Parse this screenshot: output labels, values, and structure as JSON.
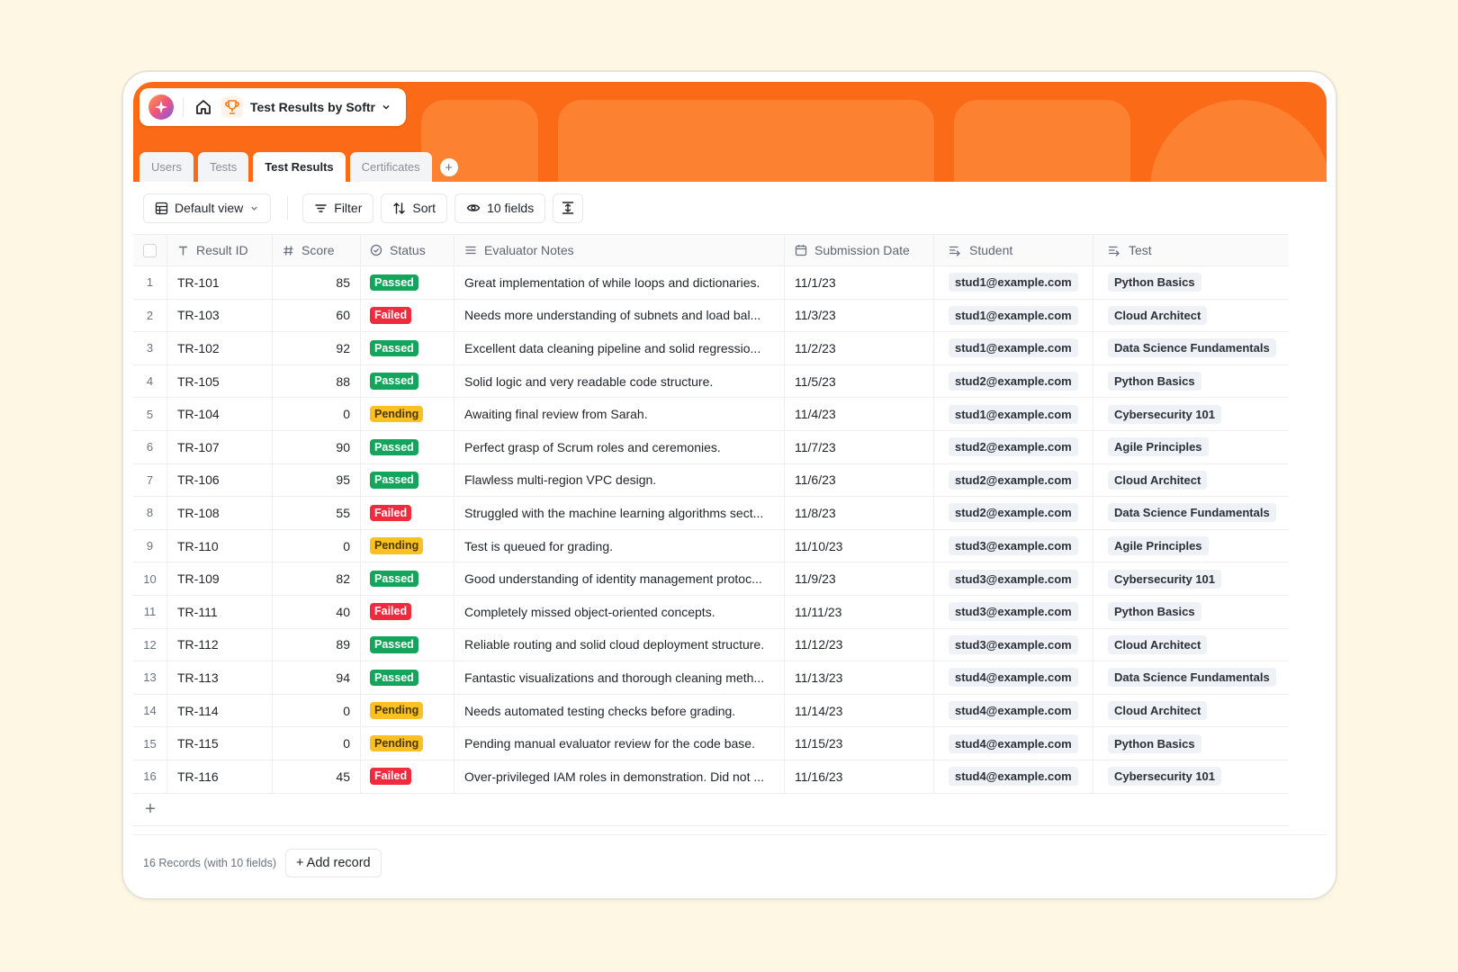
{
  "app": {
    "title": "Test Results by Softr",
    "tabs": [
      "Users",
      "Tests",
      "Test Results",
      "Certificates"
    ],
    "active_tab": "Test Results",
    "add_tab_label": "+"
  },
  "toolbar": {
    "view_label": "Default view",
    "filter_label": "Filter",
    "sort_label": "Sort",
    "fields_label": "10 fields"
  },
  "columns": {
    "result_id": "Result ID",
    "score": "Score",
    "status": "Status",
    "notes": "Evaluator Notes",
    "date": "Submission Date",
    "student": "Student",
    "test": "Test"
  },
  "rows": [
    {
      "idx": "1",
      "id": "TR-101",
      "score": "85",
      "status": "Passed",
      "notes": "Great implementation of while loops and dictionaries.",
      "date": "11/1/23",
      "student": "stud1@example.com",
      "test": "Python Basics"
    },
    {
      "idx": "2",
      "id": "TR-103",
      "score": "60",
      "status": "Failed",
      "notes": "Needs more understanding of subnets and load bal...",
      "date": "11/3/23",
      "student": "stud1@example.com",
      "test": "Cloud Architect"
    },
    {
      "idx": "3",
      "id": "TR-102",
      "score": "92",
      "status": "Passed",
      "notes": "Excellent data cleaning pipeline and solid regressio...",
      "date": "11/2/23",
      "student": "stud1@example.com",
      "test": "Data Science Fundamentals"
    },
    {
      "idx": "4",
      "id": "TR-105",
      "score": "88",
      "status": "Passed",
      "notes": "Solid logic and very readable code structure.",
      "date": "11/5/23",
      "student": "stud2@example.com",
      "test": "Python Basics"
    },
    {
      "idx": "5",
      "id": "TR-104",
      "score": "0",
      "status": "Pending",
      "notes": "Awaiting final review from Sarah.",
      "date": "11/4/23",
      "student": "stud1@example.com",
      "test": "Cybersecurity 101"
    },
    {
      "idx": "6",
      "id": "TR-107",
      "score": "90",
      "status": "Passed",
      "notes": "Perfect grasp of Scrum roles and ceremonies.",
      "date": "11/7/23",
      "student": "stud2@example.com",
      "test": "Agile Principles"
    },
    {
      "idx": "7",
      "id": "TR-106",
      "score": "95",
      "status": "Passed",
      "notes": "Flawless multi-region VPC design.",
      "date": "11/6/23",
      "student": "stud2@example.com",
      "test": "Cloud Architect"
    },
    {
      "idx": "8",
      "id": "TR-108",
      "score": "55",
      "status": "Failed",
      "notes": "Struggled with the machine learning algorithms sect...",
      "date": "11/8/23",
      "student": "stud2@example.com",
      "test": "Data Science Fundamentals"
    },
    {
      "idx": "9",
      "id": "TR-110",
      "score": "0",
      "status": "Pending",
      "notes": "Test is queued for grading.",
      "date": "11/10/23",
      "student": "stud3@example.com",
      "test": "Agile Principles"
    },
    {
      "idx": "10",
      "id": "TR-109",
      "score": "82",
      "status": "Passed",
      "notes": "Good understanding of identity management protoc...",
      "date": "11/9/23",
      "student": "stud3@example.com",
      "test": "Cybersecurity 101"
    },
    {
      "idx": "11",
      "id": "TR-111",
      "score": "40",
      "status": "Failed",
      "notes": "Completely missed object-oriented concepts.",
      "date": "11/11/23",
      "student": "stud3@example.com",
      "test": "Python Basics"
    },
    {
      "idx": "12",
      "id": "TR-112",
      "score": "89",
      "status": "Passed",
      "notes": "Reliable routing and solid cloud deployment structure.",
      "date": "11/12/23",
      "student": "stud3@example.com",
      "test": "Cloud Architect"
    },
    {
      "idx": "13",
      "id": "TR-113",
      "score": "94",
      "status": "Passed",
      "notes": "Fantastic visualizations and thorough cleaning meth...",
      "date": "11/13/23",
      "student": "stud4@example.com",
      "test": "Data Science Fundamentals"
    },
    {
      "idx": "14",
      "id": "TR-114",
      "score": "0",
      "status": "Pending",
      "notes": "Needs automated testing checks before grading.",
      "date": "11/14/23",
      "student": "stud4@example.com",
      "test": "Cloud Architect"
    },
    {
      "idx": "15",
      "id": "TR-115",
      "score": "0",
      "status": "Pending",
      "notes": "Pending manual evaluator review for the code base.",
      "date": "11/15/23",
      "student": "stud4@example.com",
      "test": "Python Basics"
    },
    {
      "idx": "16",
      "id": "TR-116",
      "score": "45",
      "status": "Failed",
      "notes": "Over-privileged IAM roles in demonstration. Did not ...",
      "date": "11/16/23",
      "student": "stud4@example.com",
      "test": "Cybersecurity 101"
    }
  ],
  "add_row_label": "+",
  "footer": {
    "record_count": "16 Records (with 10 fields)",
    "add_record_label": "+ Add record"
  },
  "colors": {
    "header_orange": "#fb6a16",
    "passed": "#13a55b",
    "failed": "#ef2b3d",
    "pending": "#fbc123",
    "page_bg": "#fdf7e3"
  }
}
